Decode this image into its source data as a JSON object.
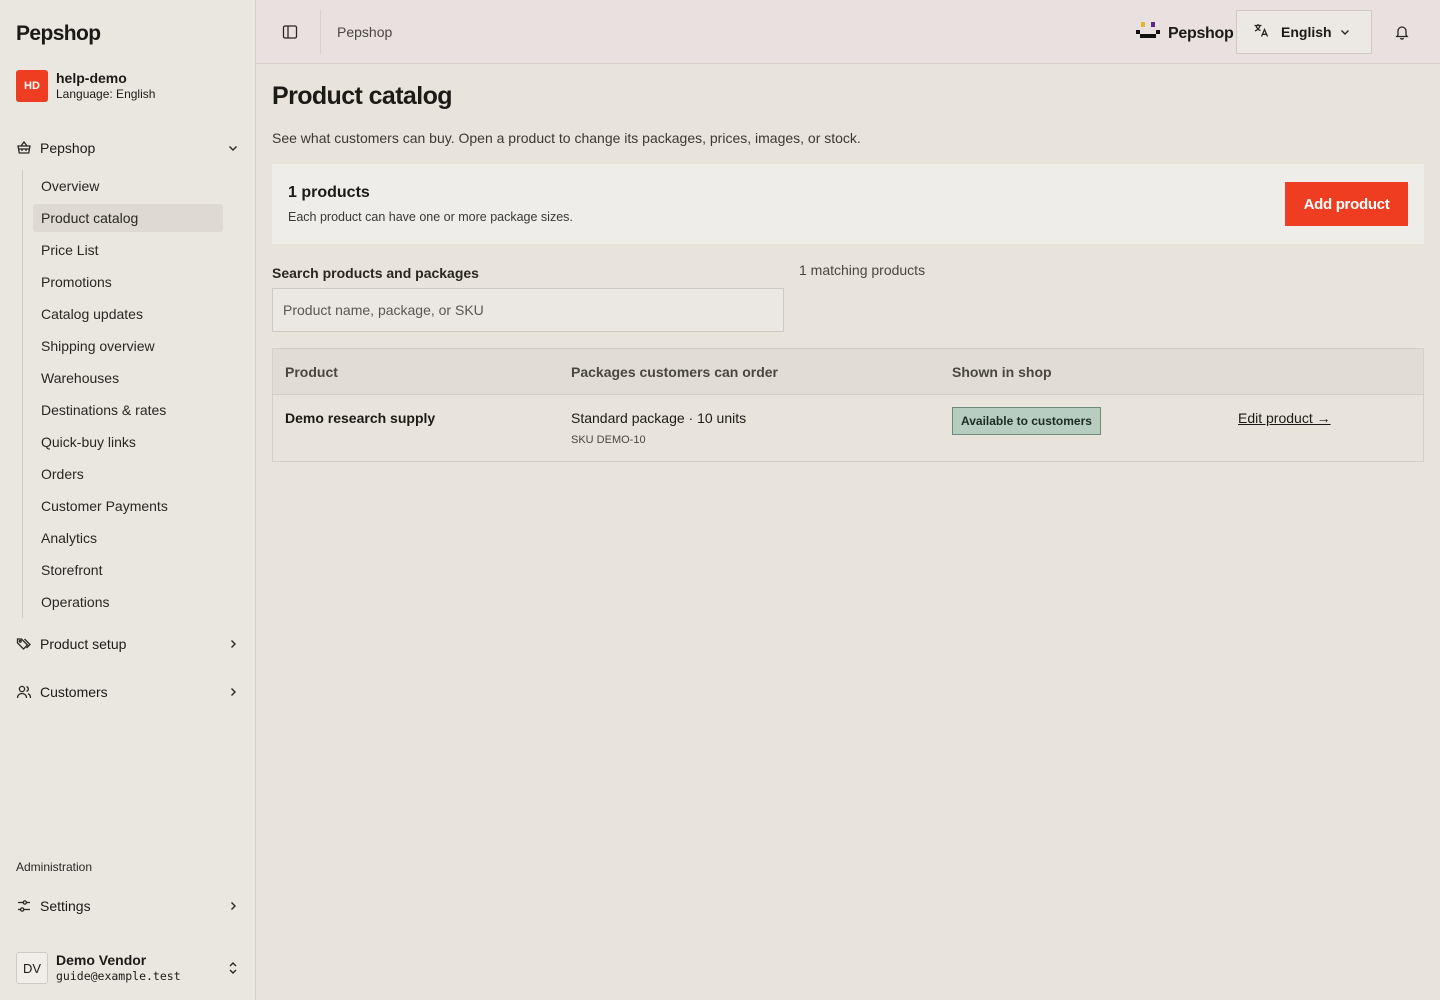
{
  "sidebar": {
    "brand": "Pepshop",
    "org": {
      "initials": "HD",
      "name": "help-demo",
      "language": "Language: English"
    },
    "groups": [
      {
        "label": "Pepshop",
        "icon": "basket-icon",
        "expanded": true
      },
      {
        "label": "Product setup",
        "icon": "tags-icon",
        "expanded": false
      },
      {
        "label": "Customers",
        "icon": "users-icon",
        "expanded": false
      }
    ],
    "items": [
      {
        "label": "Overview"
      },
      {
        "label": "Product catalog",
        "active": true
      },
      {
        "label": "Price List"
      },
      {
        "label": "Promotions"
      },
      {
        "label": "Catalog updates"
      },
      {
        "label": "Shipping overview"
      },
      {
        "label": "Warehouses"
      },
      {
        "label": "Destinations & rates"
      },
      {
        "label": "Quick-buy links"
      },
      {
        "label": "Orders"
      },
      {
        "label": "Customer Payments"
      },
      {
        "label": "Analytics"
      },
      {
        "label": "Storefront"
      },
      {
        "label": "Operations"
      }
    ],
    "admin_label": "Administration",
    "settings_label": "Settings",
    "user": {
      "initials": "DV",
      "name": "Demo Vendor",
      "email": "guide@example.test"
    }
  },
  "topbar": {
    "breadcrumb": "Pepshop",
    "logo_text": "Pepshop",
    "language": "English"
  },
  "main": {
    "title": "Product catalog",
    "description": "See what customers can buy. Open a product to change its packages, prices, images, or stock.",
    "summary": {
      "count": "1 products",
      "hint": "Each product can have one or more package sizes.",
      "add_label": "Add product"
    },
    "search": {
      "label": "Search products and packages",
      "placeholder": "Product name, package, or SKU",
      "match_count": "1 matching products"
    },
    "table": {
      "headers": [
        "Product",
        "Packages customers can order",
        "Shown in shop"
      ],
      "rows": [
        {
          "product": "Demo research supply",
          "package": "Standard package · 10 units",
          "sku": "SKU DEMO-10",
          "status": "Available to customers",
          "action": "Edit product →"
        }
      ]
    }
  },
  "colors": {
    "accent": "#ee3d20",
    "status_bg": "#b7cdc2",
    "status_border": "#6e8a7c"
  }
}
